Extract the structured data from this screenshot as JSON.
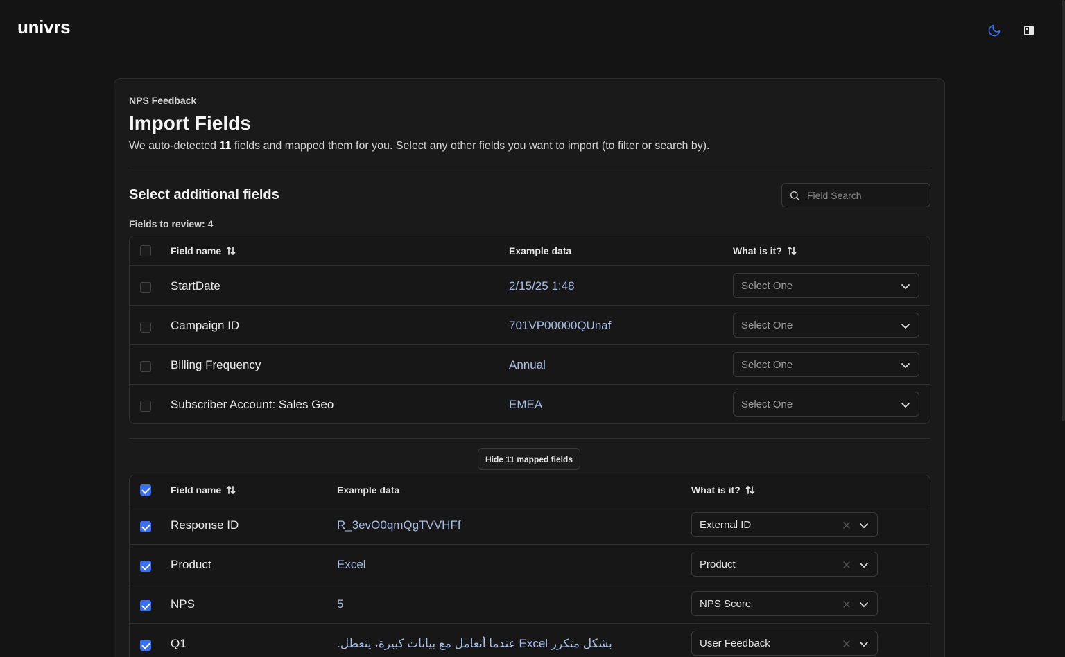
{
  "app": {
    "logo": "univrs",
    "theme_icon": "moon-icon",
    "profile_icon": "user-avatar-icon"
  },
  "header": {
    "breadcrumb": "NPS Feedback",
    "title": "Import Fields",
    "subtitle_pre": "We auto-detected ",
    "subtitle_count": "11",
    "subtitle_post": " fields and mapped them for you. Select any other fields you want to import (to filter or search by)."
  },
  "additional": {
    "title": "Select additional fields",
    "search_placeholder": "Field Search",
    "review_label": "Fields to review: 4",
    "columns": {
      "name": "Field name",
      "example": "Example data",
      "what": "What is it?"
    },
    "rows": [
      {
        "name": "StartDate",
        "example": "2/15/25 1:48",
        "select": "Select One",
        "checked": false
      },
      {
        "name": "Campaign ID",
        "example": "701VP00000QUnaf",
        "select": "Select One",
        "checked": false
      },
      {
        "name": "Billing Frequency",
        "example": "Annual",
        "select": "Select One",
        "checked": false
      },
      {
        "name": "Subscriber Account: Sales Geo",
        "example": "EMEA",
        "select": "Select One",
        "checked": false
      }
    ]
  },
  "mapped": {
    "toggle_label": "Hide 11 mapped fields",
    "columns": {
      "name": "Field name",
      "example": "Example data",
      "what": "What is it?"
    },
    "rows": [
      {
        "name": "Response ID",
        "example": "R_3evO0qmQgTVVHFf",
        "select": "External ID",
        "checked": true
      },
      {
        "name": "Product",
        "example": "Excel",
        "select": "Product",
        "checked": true
      },
      {
        "name": "NPS",
        "example": "5",
        "select": "NPS Score",
        "checked": true
      },
      {
        "name": "Q1",
        "example": "بشكل متكرر Excel عندما أتعامل مع بيانات كبيرة، يتعطل.",
        "select": "User Feedback",
        "checked": true
      }
    ]
  },
  "colors": {
    "background": "#141414",
    "card": "#1a1a1a",
    "accent": "#3b6ff0",
    "example_text": "#a9bde6"
  }
}
